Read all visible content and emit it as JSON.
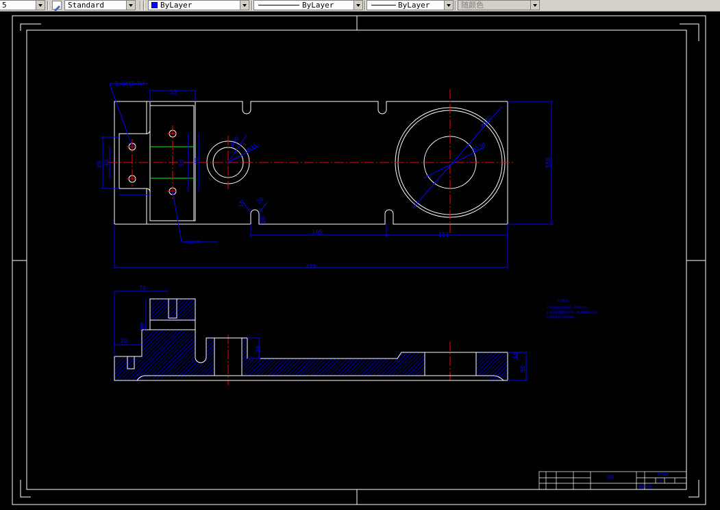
{
  "toolbar": {
    "first_value": "5",
    "text_style": "Standard",
    "color": "ByLayer",
    "color_swatch": "#0000ff",
    "linetype": "ByLayer",
    "lineweight": "ByLayer",
    "plot_style": "随颜色"
  },
  "drawing": {
    "dims": {
      "thread_note": "2×M10-7H",
      "d53": "53",
      "d80": "80",
      "d40": "40",
      "d50": "50",
      "d70": "70",
      "d130": "130",
      "d165": "165",
      "d150": "150",
      "d477": "477",
      "d150r": "150",
      "bolt_note": "4×M8-7H",
      "dia_bore": "Φ52H7",
      "dia_small": "Φ30",
      "dia_hole": "Φ35",
      "dia_big": "Φ200",
      "dia_inner": "Φ130",
      "s16": "16",
      "s20a": "20",
      "s20b": "20",
      "f70": "70",
      "f30": "30",
      "f20": "20",
      "f25": "25",
      "f50": "50",
      "f30r": "30"
    },
    "notes": {
      "title": "技术要求",
      "line1": "1.铸件应经时效处理，消除内应力。",
      "line2": "2.未注铸造圆角R3-R5，未注倒角C1mm。",
      "line3": "3.铸件表面不得有砂眼。"
    },
    "title_block": {
      "part_name": "底座",
      "material": "HT200",
      "drawing_no": "图样代号",
      "scale": "1:1"
    },
    "colors": {
      "outline": "#ffffff",
      "dimension": "#0000ff",
      "centerline": "#ff0000",
      "thread": "#00ff00"
    }
  }
}
